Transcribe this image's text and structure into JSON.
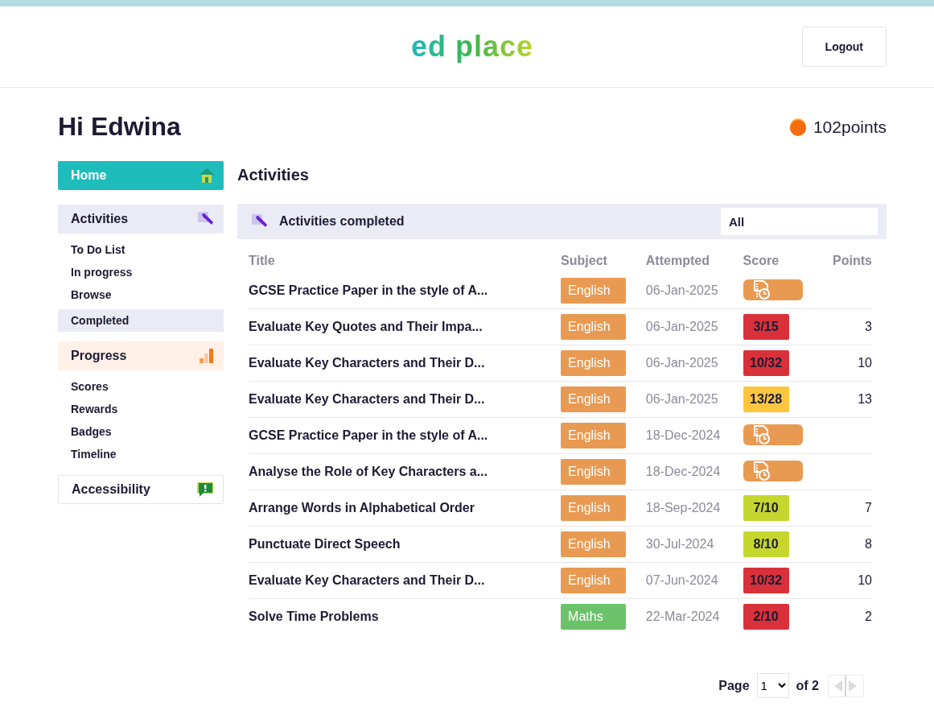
{
  "header": {
    "logo": "ed place",
    "logout": "Logout"
  },
  "greeting": "Hi Edwina",
  "points": "102points",
  "sidebar": [
    {
      "label": "Home",
      "color": "#1fbcbc"
    },
    {
      "label": "Activities",
      "color": "#ebebf5",
      "children": [
        {
          "label": "To Do List",
          "selected": false
        },
        {
          "label": "In progress",
          "selected": false
        },
        {
          "label": "Browse",
          "selected": false
        },
        {
          "label": "Completed",
          "selected": true
        }
      ]
    },
    {
      "label": "Progress",
      "color": "#fff0e8",
      "children": [
        {
          "label": "Scores",
          "selected": false
        },
        {
          "label": "Rewards",
          "selected": false
        },
        {
          "label": "Badges",
          "selected": false
        },
        {
          "label": "Timeline",
          "selected": false
        }
      ]
    },
    {
      "label": "Accessibility",
      "color": "#ffffff"
    }
  ],
  "main": {
    "title": "Activities",
    "panel_title": "Activities completed",
    "filter": "All",
    "columns": [
      "Title",
      "Subject",
      "Attempted",
      "Score",
      "Points"
    ],
    "rows": [
      {
        "title": "GCSE Practice Paper in the style of A...",
        "subject": {
          "label": "English",
          "color": "#e99a52"
        },
        "attempted": "06-Jan-2025",
        "score": {
          "kind": "pending"
        },
        "points": ""
      },
      {
        "title": "Evaluate Key Quotes and Their Impa...",
        "subject": {
          "label": "English",
          "color": "#e99a52"
        },
        "attempted": "06-Jan-2025",
        "score": {
          "kind": "mark",
          "text": "3/15",
          "color": "#d9313a"
        },
        "points": "3"
      },
      {
        "title": "Evaluate Key Characters and Their D...",
        "subject": {
          "label": "English",
          "color": "#e99a52"
        },
        "attempted": "06-Jan-2025",
        "score": {
          "kind": "mark",
          "text": "10/32",
          "color": "#d9313a"
        },
        "points": "10"
      },
      {
        "title": "Evaluate Key Characters and Their D...",
        "subject": {
          "label": "English",
          "color": "#e99a52"
        },
        "attempted": "06-Jan-2025",
        "score": {
          "kind": "mark",
          "text": "13/28",
          "color": "#fec53e"
        },
        "points": "13"
      },
      {
        "title": "GCSE Practice Paper in the style of A...",
        "subject": {
          "label": "English",
          "color": "#e99a52"
        },
        "attempted": "18-Dec-2024",
        "score": {
          "kind": "pending"
        },
        "points": ""
      },
      {
        "title": "Analyse the Role of Key Characters a...",
        "subject": {
          "label": "English",
          "color": "#e99a52"
        },
        "attempted": "18-Dec-2024",
        "score": {
          "kind": "pending"
        },
        "points": ""
      },
      {
        "title": "Arrange Words in Alphabetical Order",
        "subject": {
          "label": "English",
          "color": "#e99a52"
        },
        "attempted": "18-Sep-2024",
        "score": {
          "kind": "mark",
          "text": "7/10",
          "color": "#c5d62e"
        },
        "points": "7"
      },
      {
        "title": "Punctuate Direct Speech",
        "subject": {
          "label": "English",
          "color": "#e99a52"
        },
        "attempted": "30-Jul-2024",
        "score": {
          "kind": "mark",
          "text": "8/10",
          "color": "#c5d62e"
        },
        "points": "8"
      },
      {
        "title": "Evaluate Key Characters and Their D...",
        "subject": {
          "label": "English",
          "color": "#e99a52"
        },
        "attempted": "07-Jun-2024",
        "score": {
          "kind": "mark",
          "text": "10/32",
          "color": "#d9313a"
        },
        "points": "10"
      },
      {
        "title": "Solve Time Problems",
        "subject": {
          "label": "Maths",
          "color": "#6cc26b"
        },
        "attempted": "22-Mar-2024",
        "score": {
          "kind": "mark",
          "text": "2/10",
          "color": "#d9313a"
        },
        "points": "2"
      }
    ],
    "pagination": {
      "label": "Page",
      "page": "1",
      "of": "of 2"
    }
  }
}
